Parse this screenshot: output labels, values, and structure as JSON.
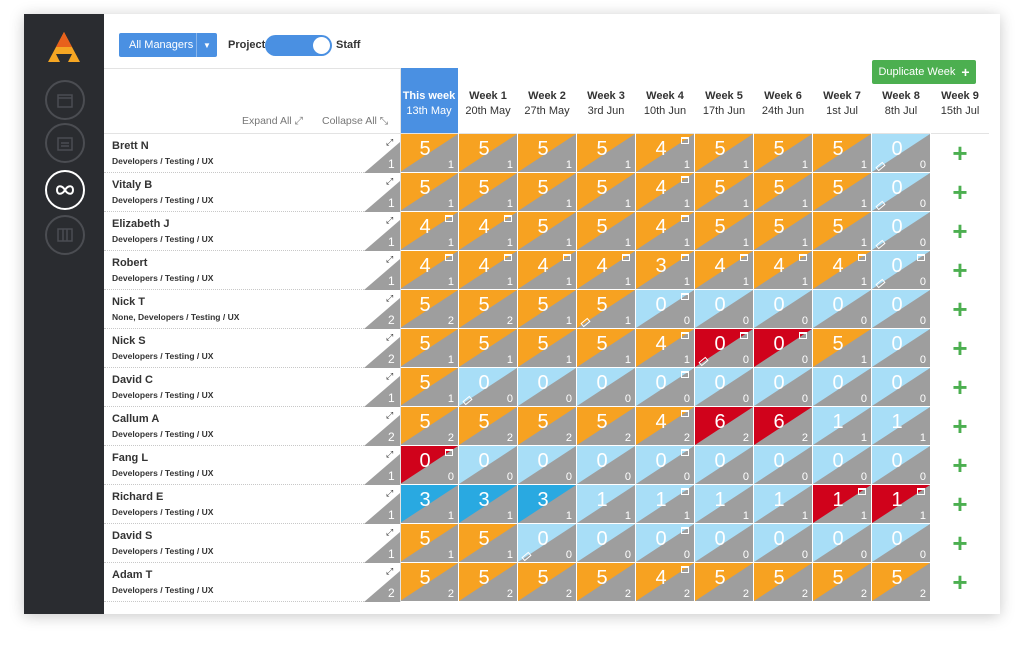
{
  "toolbar": {
    "manager_select": "All Managers",
    "toggle_left": "Project",
    "toggle_right": "Staff",
    "duplicate_label": "Duplicate Week"
  },
  "header": {
    "expand_all": "Expand All",
    "collapse_all": "Collapse All"
  },
  "weeks": [
    {
      "title": "This week",
      "date": "13th May"
    },
    {
      "title": "Week 1",
      "date": "20th May"
    },
    {
      "title": "Week 2",
      "date": "27th May"
    },
    {
      "title": "Week 3",
      "date": "3rd Jun"
    },
    {
      "title": "Week 4",
      "date": "10th Jun"
    },
    {
      "title": "Week 5",
      "date": "17th Jun"
    },
    {
      "title": "Week 6",
      "date": "24th Jun"
    },
    {
      "title": "Week 7",
      "date": "1st Jul"
    },
    {
      "title": "Week 8",
      "date": "8th Jul"
    },
    {
      "title": "Week 9",
      "date": "15th Jul"
    }
  ],
  "colors": {
    "orange": "#f7a221",
    "light_blue": "#a8def7",
    "blue": "#29a9e1",
    "red": "#d0021b",
    "accent": "#4a90e2",
    "green": "#4caf50"
  },
  "rows": [
    {
      "name": "Brett N",
      "team": "Developers / Testing / UX",
      "capacity": "1",
      "cells": [
        {
          "v": "5",
          "c": "1",
          "k": "orange"
        },
        {
          "v": "5",
          "c": "1",
          "k": "orange"
        },
        {
          "v": "5",
          "c": "1",
          "k": "orange"
        },
        {
          "v": "5",
          "c": "1",
          "k": "orange"
        },
        {
          "v": "4",
          "c": "1",
          "k": "orange",
          "cal": true
        },
        {
          "v": "5",
          "c": "1",
          "k": "orange"
        },
        {
          "v": "5",
          "c": "1",
          "k": "orange"
        },
        {
          "v": "5",
          "c": "1",
          "k": "orange"
        },
        {
          "v": "0",
          "c": "0",
          "k": "light_blue",
          "pin": true
        }
      ]
    },
    {
      "name": "Vitaly B",
      "team": "Developers / Testing / UX",
      "capacity": "1",
      "cells": [
        {
          "v": "5",
          "c": "1",
          "k": "orange"
        },
        {
          "v": "5",
          "c": "1",
          "k": "orange"
        },
        {
          "v": "5",
          "c": "1",
          "k": "orange"
        },
        {
          "v": "5",
          "c": "1",
          "k": "orange"
        },
        {
          "v": "4",
          "c": "1",
          "k": "orange",
          "cal": true
        },
        {
          "v": "5",
          "c": "1",
          "k": "orange"
        },
        {
          "v": "5",
          "c": "1",
          "k": "orange"
        },
        {
          "v": "5",
          "c": "1",
          "k": "orange"
        },
        {
          "v": "0",
          "c": "0",
          "k": "light_blue",
          "pin": true
        }
      ]
    },
    {
      "name": "Elizabeth J",
      "team": "Developers / Testing / UX",
      "capacity": "1",
      "cells": [
        {
          "v": "4",
          "c": "1",
          "k": "orange",
          "cal": true
        },
        {
          "v": "4",
          "c": "1",
          "k": "orange",
          "cal": true
        },
        {
          "v": "5",
          "c": "1",
          "k": "orange"
        },
        {
          "v": "5",
          "c": "1",
          "k": "orange"
        },
        {
          "v": "4",
          "c": "1",
          "k": "orange",
          "cal": true
        },
        {
          "v": "5",
          "c": "1",
          "k": "orange"
        },
        {
          "v": "5",
          "c": "1",
          "k": "orange"
        },
        {
          "v": "5",
          "c": "1",
          "k": "orange"
        },
        {
          "v": "0",
          "c": "0",
          "k": "light_blue",
          "pin": true
        }
      ]
    },
    {
      "name": "Robert",
      "team": "Developers / Testing / UX",
      "capacity": "1",
      "cells": [
        {
          "v": "4",
          "c": "1",
          "k": "orange",
          "cal": true
        },
        {
          "v": "4",
          "c": "1",
          "k": "orange",
          "cal": true
        },
        {
          "v": "4",
          "c": "1",
          "k": "orange",
          "cal": true
        },
        {
          "v": "4",
          "c": "1",
          "k": "orange",
          "cal": true
        },
        {
          "v": "3",
          "c": "1",
          "k": "orange",
          "cal": true
        },
        {
          "v": "4",
          "c": "1",
          "k": "orange",
          "cal": true
        },
        {
          "v": "4",
          "c": "1",
          "k": "orange",
          "cal": true
        },
        {
          "v": "4",
          "c": "1",
          "k": "orange",
          "cal": true
        },
        {
          "v": "0",
          "c": "0",
          "k": "light_blue",
          "cal": true,
          "pin": true
        }
      ]
    },
    {
      "name": "Nick T",
      "team": "None, Developers / Testing / UX",
      "capacity": "2",
      "cells": [
        {
          "v": "5",
          "c": "2",
          "k": "orange"
        },
        {
          "v": "5",
          "c": "2",
          "k": "orange"
        },
        {
          "v": "5",
          "c": "1",
          "k": "orange"
        },
        {
          "v": "5",
          "c": "1",
          "k": "orange",
          "pin": true
        },
        {
          "v": "0",
          "c": "0",
          "k": "light_blue",
          "cal": true
        },
        {
          "v": "0",
          "c": "0",
          "k": "light_blue"
        },
        {
          "v": "0",
          "c": "0",
          "k": "light_blue"
        },
        {
          "v": "0",
          "c": "0",
          "k": "light_blue"
        },
        {
          "v": "0",
          "c": "0",
          "k": "light_blue"
        }
      ]
    },
    {
      "name": "Nick S",
      "team": "Developers / Testing / UX",
      "capacity": "2",
      "cells": [
        {
          "v": "5",
          "c": "1",
          "k": "orange"
        },
        {
          "v": "5",
          "c": "1",
          "k": "orange"
        },
        {
          "v": "5",
          "c": "1",
          "k": "orange"
        },
        {
          "v": "5",
          "c": "1",
          "k": "orange"
        },
        {
          "v": "4",
          "c": "1",
          "k": "orange",
          "cal": true
        },
        {
          "v": "0",
          "c": "0",
          "k": "red",
          "cal": true,
          "pin": true
        },
        {
          "v": "0",
          "c": "0",
          "k": "red",
          "cal": true
        },
        {
          "v": "5",
          "c": "1",
          "k": "orange"
        },
        {
          "v": "0",
          "c": "0",
          "k": "light_blue"
        }
      ]
    },
    {
      "name": "David C",
      "team": "Developers / Testing / UX",
      "capacity": "1",
      "cells": [
        {
          "v": "5",
          "c": "1",
          "k": "orange"
        },
        {
          "v": "0",
          "c": "0",
          "k": "light_blue",
          "pin": true
        },
        {
          "v": "0",
          "c": "0",
          "k": "light_blue"
        },
        {
          "v": "0",
          "c": "0",
          "k": "light_blue"
        },
        {
          "v": "0",
          "c": "0",
          "k": "light_blue",
          "cal": true
        },
        {
          "v": "0",
          "c": "0",
          "k": "light_blue"
        },
        {
          "v": "0",
          "c": "0",
          "k": "light_blue"
        },
        {
          "v": "0",
          "c": "0",
          "k": "light_blue"
        },
        {
          "v": "0",
          "c": "0",
          "k": "light_blue"
        }
      ]
    },
    {
      "name": "Callum A",
      "team": "Developers / Testing / UX",
      "capacity": "2",
      "cells": [
        {
          "v": "5",
          "c": "2",
          "k": "orange"
        },
        {
          "v": "5",
          "c": "2",
          "k": "orange"
        },
        {
          "v": "5",
          "c": "2",
          "k": "orange"
        },
        {
          "v": "5",
          "c": "2",
          "k": "orange"
        },
        {
          "v": "4",
          "c": "2",
          "k": "orange",
          "cal": true
        },
        {
          "v": "6",
          "c": "2",
          "k": "red"
        },
        {
          "v": "6",
          "c": "2",
          "k": "red"
        },
        {
          "v": "1",
          "c": "1",
          "k": "light_blue"
        },
        {
          "v": "1",
          "c": "1",
          "k": "light_blue"
        }
      ]
    },
    {
      "name": "Fang L",
      "team": "Developers / Testing / UX",
      "capacity": "1",
      "cells": [
        {
          "v": "0",
          "c": "0",
          "k": "red",
          "cal": true
        },
        {
          "v": "0",
          "c": "0",
          "k": "light_blue"
        },
        {
          "v": "0",
          "c": "0",
          "k": "light_blue"
        },
        {
          "v": "0",
          "c": "0",
          "k": "light_blue"
        },
        {
          "v": "0",
          "c": "0",
          "k": "light_blue",
          "cal": true
        },
        {
          "v": "0",
          "c": "0",
          "k": "light_blue"
        },
        {
          "v": "0",
          "c": "0",
          "k": "light_blue"
        },
        {
          "v": "0",
          "c": "0",
          "k": "light_blue"
        },
        {
          "v": "0",
          "c": "0",
          "k": "light_blue"
        }
      ]
    },
    {
      "name": "Richard E",
      "team": "Developers / Testing / UX",
      "capacity": "1",
      "cells": [
        {
          "v": "3",
          "c": "1",
          "k": "blue"
        },
        {
          "v": "3",
          "c": "1",
          "k": "blue"
        },
        {
          "v": "3",
          "c": "1",
          "k": "blue"
        },
        {
          "v": "1",
          "c": "1",
          "k": "light_blue"
        },
        {
          "v": "1",
          "c": "1",
          "k": "light_blue",
          "cal": true
        },
        {
          "v": "1",
          "c": "1",
          "k": "light_blue"
        },
        {
          "v": "1",
          "c": "1",
          "k": "light_blue"
        },
        {
          "v": "1",
          "c": "1",
          "k": "red",
          "cal": true
        },
        {
          "v": "1",
          "c": "1",
          "k": "red",
          "cal": true
        }
      ]
    },
    {
      "name": "David S",
      "team": "Developers / Testing / UX",
      "capacity": "1",
      "cells": [
        {
          "v": "5",
          "c": "1",
          "k": "orange"
        },
        {
          "v": "5",
          "c": "1",
          "k": "orange"
        },
        {
          "v": "0",
          "c": "0",
          "k": "light_blue",
          "pin": true
        },
        {
          "v": "0",
          "c": "0",
          "k": "light_blue"
        },
        {
          "v": "0",
          "c": "0",
          "k": "light_blue",
          "cal": true
        },
        {
          "v": "0",
          "c": "0",
          "k": "light_blue"
        },
        {
          "v": "0",
          "c": "0",
          "k": "light_blue"
        },
        {
          "v": "0",
          "c": "0",
          "k": "light_blue"
        },
        {
          "v": "0",
          "c": "0",
          "k": "light_blue"
        }
      ]
    },
    {
      "name": "Adam T",
      "team": "Developers / Testing / UX",
      "capacity": "2",
      "cells": [
        {
          "v": "5",
          "c": "2",
          "k": "orange"
        },
        {
          "v": "5",
          "c": "2",
          "k": "orange"
        },
        {
          "v": "5",
          "c": "2",
          "k": "orange"
        },
        {
          "v": "5",
          "c": "2",
          "k": "orange"
        },
        {
          "v": "4",
          "c": "2",
          "k": "orange",
          "cal": true
        },
        {
          "v": "5",
          "c": "2",
          "k": "orange"
        },
        {
          "v": "5",
          "c": "2",
          "k": "orange"
        },
        {
          "v": "5",
          "c": "2",
          "k": "orange"
        },
        {
          "v": "5",
          "c": "2",
          "k": "orange"
        }
      ]
    }
  ]
}
